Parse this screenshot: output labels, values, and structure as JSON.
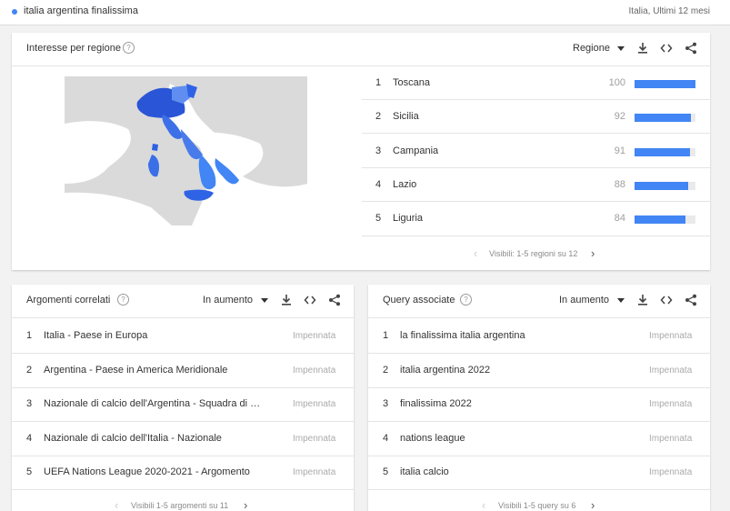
{
  "header": {
    "search_term": "italia argentina finalissima",
    "scope": "Italia, Ultimi 12 mesi"
  },
  "regions": {
    "title": "Interesse per regione",
    "resolution_label": "Regione",
    "items": [
      {
        "rank": "1",
        "name": "Toscana",
        "value": "100",
        "score": 100
      },
      {
        "rank": "2",
        "name": "Sicilia",
        "value": "92",
        "score": 92
      },
      {
        "rank": "3",
        "name": "Campania",
        "value": "91",
        "score": 91
      },
      {
        "rank": "4",
        "name": "Lazio",
        "value": "88",
        "score": 88
      },
      {
        "rank": "5",
        "name": "Liguria",
        "value": "84",
        "score": 84
      }
    ],
    "pager": "Visibili: 1-5 regioni su 12",
    "bar_color": "#4285f4"
  },
  "topics": {
    "title": "Argomenti correlati",
    "filter_label": "In aumento",
    "items": [
      {
        "rank": "1",
        "name": "Italia - Paese in Europa",
        "trend": "Impennata"
      },
      {
        "rank": "2",
        "name": "Argentina - Paese in America Meridionale",
        "trend": "Impennata"
      },
      {
        "rank": "3",
        "name": "Nazionale di calcio dell'Argentina - Squadra di …",
        "trend": "Impennata"
      },
      {
        "rank": "4",
        "name": "Nazionale di calcio dell'Italia - Nazionale",
        "trend": "Impennata"
      },
      {
        "rank": "5",
        "name": "UEFA Nations League 2020-2021 - Argomento",
        "trend": "Impennata"
      }
    ],
    "pager": "Visibili 1-5 argomenti su 11"
  },
  "queries": {
    "title": "Query associate",
    "filter_label": "In aumento",
    "items": [
      {
        "rank": "1",
        "name": "la finalissima italia argentina",
        "trend": "Impennata"
      },
      {
        "rank": "2",
        "name": "italia argentina 2022",
        "trend": "Impennata"
      },
      {
        "rank": "3",
        "name": "finalissima 2022",
        "trend": "Impennata"
      },
      {
        "rank": "4",
        "name": "nations league",
        "trend": "Impennata"
      },
      {
        "rank": "5",
        "name": "italia calcio",
        "trend": "Impennata"
      }
    ],
    "pager": "Visibili 1-5 query su 6"
  },
  "icons": [
    "help-icon",
    "caret-down-icon",
    "download-icon",
    "embed-icon",
    "share-icon",
    "chevron-left-icon",
    "chevron-right-icon"
  ]
}
